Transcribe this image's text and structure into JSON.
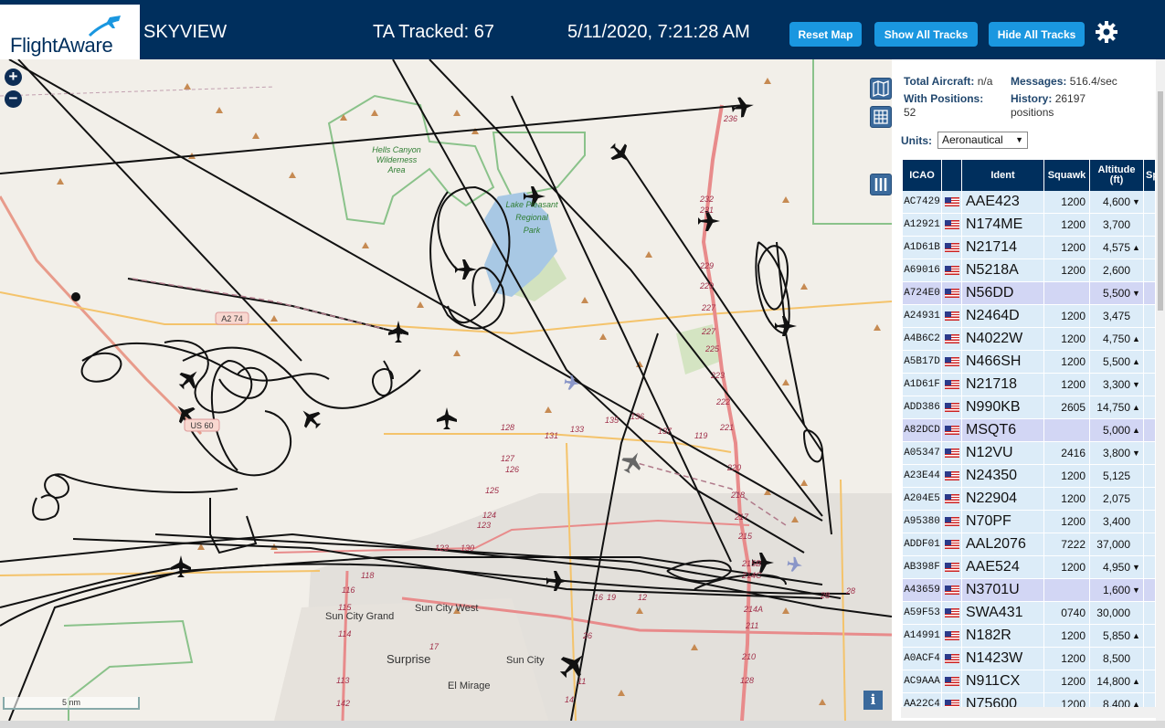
{
  "header": {
    "logo_text": "FlightAware",
    "title": "SKYVIEW",
    "ta_tracked": "TA Tracked: 67",
    "datetime": "5/11/2020, 7:21:28 AM",
    "buttons": {
      "reset": "Reset Map",
      "show": "Show All Tracks",
      "hide": "Hide All Tracks"
    },
    "settings_icon": "gear-icon",
    "colors": {
      "bar": "#002f5d",
      "button": "#1a97e0"
    }
  },
  "map": {
    "zoom_in": "+",
    "zoom_out": "−",
    "scale_label": "5 nm",
    "info_label": "i",
    "place_labels": {
      "wilderness": [
        "Hells Canyon",
        "Wilderness",
        "Area"
      ],
      "park": [
        "Lake Pleasant",
        "Regional",
        "Park"
      ],
      "sun_city_west": "Sun City West",
      "sun_city_grand": "Sun City Grand",
      "surprise": "Surprise",
      "sun_city": "Sun City",
      "el_mirage": "El Mirage"
    },
    "road_shields": {
      "a74": "A2 74",
      "us60": "US 60"
    },
    "route_numbers": [
      "236",
      "232",
      "231",
      "229",
      "229",
      "227",
      "227",
      "225",
      "223",
      "222",
      "221",
      "220",
      "218",
      "217",
      "215",
      "215B",
      "214C",
      "214A",
      "211",
      "210",
      "128",
      "128",
      "127",
      "126",
      "125",
      "124",
      "123",
      "123",
      "130",
      "131",
      "133",
      "135",
      "136",
      "137",
      "119",
      "118",
      "116",
      "115",
      "114",
      "113",
      "142",
      "17",
      "16",
      "19",
      "12",
      "11",
      "14",
      "26",
      "28",
      "28"
    ]
  },
  "panel": {
    "total_aircraft_label": "Total Aircraft:",
    "total_aircraft_value": "n/a",
    "messages_label": "Messages:",
    "messages_value": "516.4/sec",
    "with_positions_label": "With Positions:",
    "with_positions_value": "52",
    "history_label": "History:",
    "history_value": "26197 positions",
    "units_label": "Units:",
    "units_value": "Aeronautical",
    "columns": {
      "icao": "ICAO",
      "ident": "Ident",
      "squawk": "Squawk",
      "altitude": "Altitude (ft)",
      "speed": "Sp"
    },
    "rows": [
      {
        "icao": "AC7429",
        "ident": "AAE423",
        "squawk": "1200",
        "alt": "4,600",
        "trend": "down",
        "sel": false
      },
      {
        "icao": "A12921",
        "ident": "N174ME",
        "squawk": "1200",
        "alt": "3,700",
        "trend": "",
        "sel": false
      },
      {
        "icao": "A1D61B",
        "ident": "N21714",
        "squawk": "1200",
        "alt": "4,575",
        "trend": "up",
        "sel": false
      },
      {
        "icao": "A69016",
        "ident": "N5218A",
        "squawk": "1200",
        "alt": "2,600",
        "trend": "",
        "sel": false
      },
      {
        "icao": "A724E0",
        "ident": "N56DD",
        "squawk": "",
        "alt": "5,500",
        "trend": "down",
        "sel": true
      },
      {
        "icao": "A24931",
        "ident": "N2464D",
        "squawk": "1200",
        "alt": "3,475",
        "trend": "",
        "sel": false
      },
      {
        "icao": "A4B6C2",
        "ident": "N4022W",
        "squawk": "1200",
        "alt": "4,750",
        "trend": "up",
        "sel": false
      },
      {
        "icao": "A5B17D",
        "ident": "N466SH",
        "squawk": "1200",
        "alt": "5,500",
        "trend": "up",
        "sel": false
      },
      {
        "icao": "A1D61F",
        "ident": "N21718",
        "squawk": "1200",
        "alt": "3,300",
        "trend": "down",
        "sel": false
      },
      {
        "icao": "ADD386",
        "ident": "N990KB",
        "squawk": "2605",
        "alt": "14,750",
        "trend": "up",
        "sel": false
      },
      {
        "icao": "A82DCD",
        "ident": "MSQT6",
        "squawk": "",
        "alt": "5,000",
        "trend": "up",
        "sel": true
      },
      {
        "icao": "A05347",
        "ident": "N12VU",
        "squawk": "2416",
        "alt": "3,800",
        "trend": "down",
        "sel": false
      },
      {
        "icao": "A23E44",
        "ident": "N24350",
        "squawk": "1200",
        "alt": "5,125",
        "trend": "",
        "sel": false
      },
      {
        "icao": "A204E5",
        "ident": "N22904",
        "squawk": "1200",
        "alt": "2,075",
        "trend": "",
        "sel": false
      },
      {
        "icao": "A95380",
        "ident": "N70PF",
        "squawk": "1200",
        "alt": "3,400",
        "trend": "",
        "sel": false
      },
      {
        "icao": "ADDF01",
        "ident": "AAL2076",
        "squawk": "7222",
        "alt": "37,000",
        "trend": "",
        "sel": false
      },
      {
        "icao": "AB398F",
        "ident": "AAE524",
        "squawk": "1200",
        "alt": "4,950",
        "trend": "down",
        "sel": false
      },
      {
        "icao": "A43659",
        "ident": "N3701U",
        "squawk": "",
        "alt": "1,600",
        "trend": "down",
        "sel": true
      },
      {
        "icao": "A59F53",
        "ident": "SWA431",
        "squawk": "0740",
        "alt": "30,000",
        "trend": "",
        "sel": false
      },
      {
        "icao": "A14991",
        "ident": "N182R",
        "squawk": "1200",
        "alt": "5,850",
        "trend": "up",
        "sel": false
      },
      {
        "icao": "A0ACF4",
        "ident": "N1423W",
        "squawk": "1200",
        "alt": "8,500",
        "trend": "",
        "sel": false
      },
      {
        "icao": "AC9AAA",
        "ident": "N911CX",
        "squawk": "1200",
        "alt": "14,800",
        "trend": "up",
        "sel": false
      },
      {
        "icao": "AA22C4",
        "ident": "N75600",
        "squawk": "1200",
        "alt": "8,400",
        "trend": "up",
        "sel": false
      }
    ]
  }
}
